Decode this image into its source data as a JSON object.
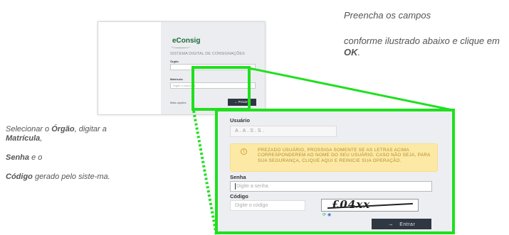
{
  "instructions": {
    "top_line1": "Preencha os campos",
    "top_line2_before": "conforme ilustrado abaixo e clique em ",
    "top_line2_bold": "OK",
    "top_line2_after": ".",
    "left_p1_a": "Selecionar o ",
    "left_p1_b": "Órgão",
    "left_p1_c": ", digitar a ",
    "left_p1_d": "Matrícula",
    "left_p1_e": ",",
    "left_p2_a": "Senha",
    "left_p2_b": " e o",
    "left_p3_a": "Código",
    "left_p3_b": " gerado pelo siste-ma."
  },
  "mini_login": {
    "logo": "eConsig",
    "title": "SISTEMA DIGITAL DE CONSIGNAÇÕES",
    "orgao_label": "Órgão",
    "matricula_label": "Matrícula",
    "matricula_placeholder": "Digite a matrícula",
    "more_options": "Mais opções",
    "button_label": "Próximo"
  },
  "zoom_panel": {
    "usuario_label": "Usuário",
    "usuario_value": "A.A.S.S.",
    "warning_icon": "info-icon",
    "warning_text": "PREZADO USUÁRIO, PROSSIGA SOMENTE SE AS LETRAS ACIMA CORRESPONDEREM AO NOME DO SEU USUÁRIO. CASO NÃO SEJA, PARA SUA SEGURANÇA, CLIQUE AQUI E REINICIE SUA OPERAÇÃO.",
    "senha_label": "Senha",
    "senha_placeholder": "Digite a senha",
    "codigo_label": "Código",
    "codigo_placeholder": "Digite o código",
    "captcha_text": "£04xx",
    "submit_label": "Entrar"
  },
  "colors": {
    "highlight": "#1ee01e",
    "button_bg": "#2e3742",
    "warning_bg": "#fde9a6"
  }
}
